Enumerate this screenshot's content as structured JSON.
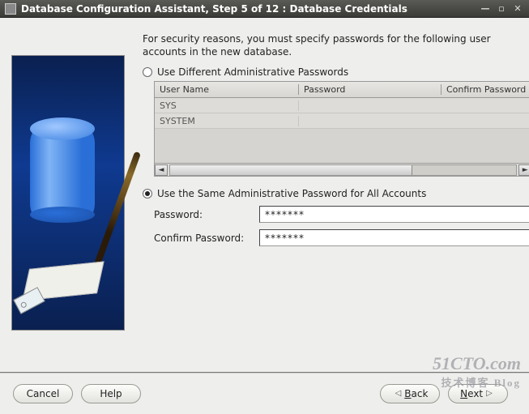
{
  "window": {
    "title": "Database Configuration Assistant, Step 5 of 12 : Database Credentials"
  },
  "intro": "For security reasons, you must specify passwords for the following user accounts in the new database.",
  "option_different": {
    "label": "Use Different Administrative Passwords",
    "selected": false
  },
  "table": {
    "headers": {
      "user": "User Name",
      "password": "Password",
      "confirm": "Confirm Password"
    },
    "rows": [
      {
        "user": "SYS"
      },
      {
        "user": "SYSTEM"
      }
    ]
  },
  "option_same": {
    "label": "Use the Same Administrative Password for All Accounts",
    "selected": true
  },
  "fields": {
    "password_label": "Password:",
    "password_value": "*******",
    "confirm_label": "Confirm Password:",
    "confirm_value": "*******"
  },
  "buttons": {
    "cancel": "Cancel",
    "help": "Help",
    "back_prefix": "B",
    "back_rest": "ack",
    "next_prefix": "N",
    "next_rest": "ext"
  },
  "watermark": {
    "main": "51CTO.com",
    "sub": "技术博客   Blog"
  }
}
